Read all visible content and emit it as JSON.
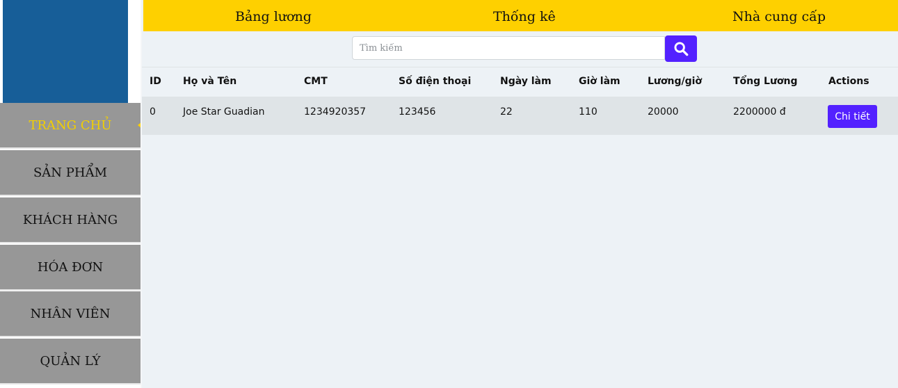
{
  "topnav": {
    "items": [
      "Bảng lương",
      "Thống kê",
      "Nhà cung cấp"
    ]
  },
  "sidebar": {
    "items": [
      {
        "label": "TRANG CHỦ",
        "active": true
      },
      {
        "label": "SẢN PHẨM",
        "active": false
      },
      {
        "label": "KHÁCH HÀNG",
        "active": false
      },
      {
        "label": "HÓA ĐƠN",
        "active": false
      },
      {
        "label": "NHÂN VIÊN",
        "active": false
      },
      {
        "label": "QUẢN LÝ",
        "active": false
      }
    ]
  },
  "search": {
    "placeholder": "Tìm kiếm",
    "value": "",
    "icon": "search-icon"
  },
  "table": {
    "columns": [
      "ID",
      "Họ và Tên",
      "CMT",
      "Số điện thoại",
      "Ngày làm",
      "Giờ làm",
      "Lương/giờ",
      "Tổng Lương",
      "Actions"
    ],
    "rows": [
      {
        "id": "0",
        "name": "Joe Star Guadian",
        "cmt": "1234920357",
        "phone": "123456",
        "days": "22",
        "hours": "110",
        "rate": "20000",
        "total": "2200000 đ",
        "action_label": "Chi tiết"
      }
    ]
  },
  "colors": {
    "topbar": "#fed000",
    "sidebar_item": "#979797",
    "sidebar_active_text": "#f2cf00",
    "logo_block": "#175e98",
    "accent": "#5321ff",
    "page_bg": "#edf2f6",
    "row_bg": "#dfe4e7"
  }
}
